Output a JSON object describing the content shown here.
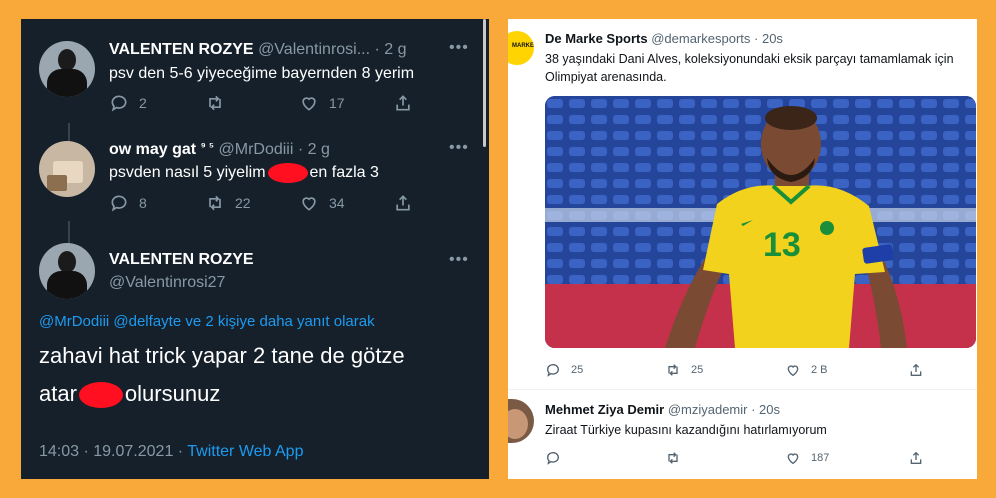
{
  "left": {
    "tweet1": {
      "name": "VALENTEN ROZYE",
      "handle": "@Valentinrosi...",
      "time": "· 2 g",
      "text": "psv den 5-6 yiyeceğime bayernden 8 yerim",
      "replies": "2",
      "likes": "17"
    },
    "tweet2": {
      "name": "ow may gat",
      "sup": "⁹ ⁵",
      "handle": "@MrDodiii",
      "time": "· 2 g",
      "text_a": "psvden nasıl 5 yiyelim",
      "text_b": "en fazla 3",
      "replies": "8",
      "retweets": "22",
      "likes": "34"
    },
    "tweet3": {
      "name": "VALENTEN ROZYE",
      "handle": "@Valentinrosi27",
      "reply_to": "@MrDodiii @delfayte ve 2 kişiye daha yanıt olarak",
      "line1": "zahavi hat trick yapar 2 tane de götze",
      "line2_a": "atar",
      "line2_b": "olursunuz",
      "timestamp": "14:03 · 19.07.2021 ·",
      "app": "Twitter Web App"
    }
  },
  "right": {
    "tweet1": {
      "name": "De Marke Sports",
      "handle": "@demarkesports",
      "time": "· 20s",
      "logo_text": "MARKE",
      "text": "38 yaşındaki Dani Alves, koleksiyonundaki eksik parçayı tamamlamak için Olimpiyat arenasında.",
      "jersey_number": "13",
      "replies": "25",
      "retweets": "25",
      "likes": "2 B"
    },
    "tweet2": {
      "name": "Mehmet Ziya Demir",
      "handle": "@mziyademir",
      "time": "· 20s",
      "text": "Ziraat Türkiye kupasını kazandığını hatırlamıyorum",
      "likes": "187"
    }
  },
  "colors": {
    "frame": "#f9a93a",
    "dark_bg": "#15202b",
    "blue": "#1d9bf0",
    "redact": "#ff0f1f",
    "jersey": "#f2d21c"
  },
  "icons": [
    "more-icon",
    "reply-icon",
    "retweet-icon",
    "like-icon",
    "share-icon"
  ]
}
